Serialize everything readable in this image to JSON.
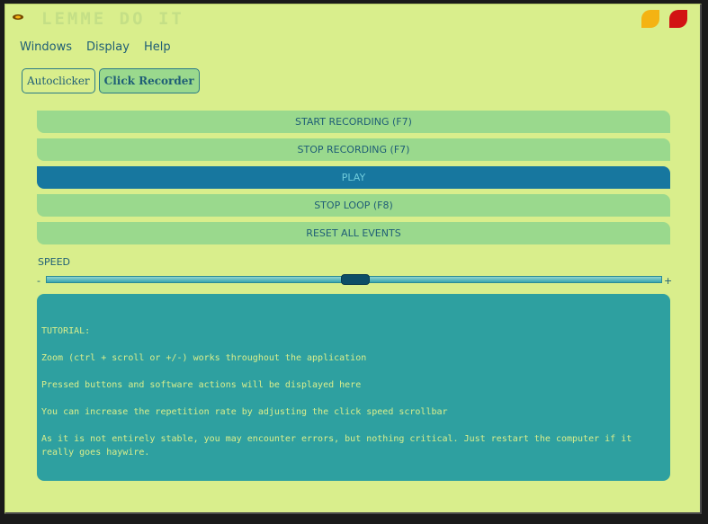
{
  "window": {
    "title": "LEMME DO IT",
    "colors": {
      "bg": "#d9ee8c",
      "minimize": "#f4b313",
      "close": "#d21313"
    }
  },
  "menu": [
    "Windows",
    "Display",
    "Help"
  ],
  "tabs": [
    {
      "label": "Autoclicker",
      "active": false
    },
    {
      "label": "Click Recorder",
      "active": true
    }
  ],
  "actions": [
    {
      "label": "START RECORDING (F7)",
      "active": false
    },
    {
      "label": "STOP RECORDING (F7)",
      "active": false
    },
    {
      "label": "PLAY",
      "active": true
    },
    {
      "label": "STOP LOOP (F8)",
      "active": false
    },
    {
      "label": "RESET ALL EVENTS",
      "active": false
    }
  ],
  "speed": {
    "label": "SPEED",
    "min_label": "-",
    "max_label": "+",
    "value_fraction": 0.5
  },
  "tutorial": {
    "lines": [
      "TUTORIAL:",
      "Zoom (ctrl + scroll or +/-) works throughout the application",
      "Pressed buttons and software actions will be displayed here",
      "You can increase the repetition rate by adjusting the click speed scrollbar",
      "As it is not entirely stable, you may encounter errors, but nothing critical. Just restart the computer if it really goes haywire."
    ]
  }
}
